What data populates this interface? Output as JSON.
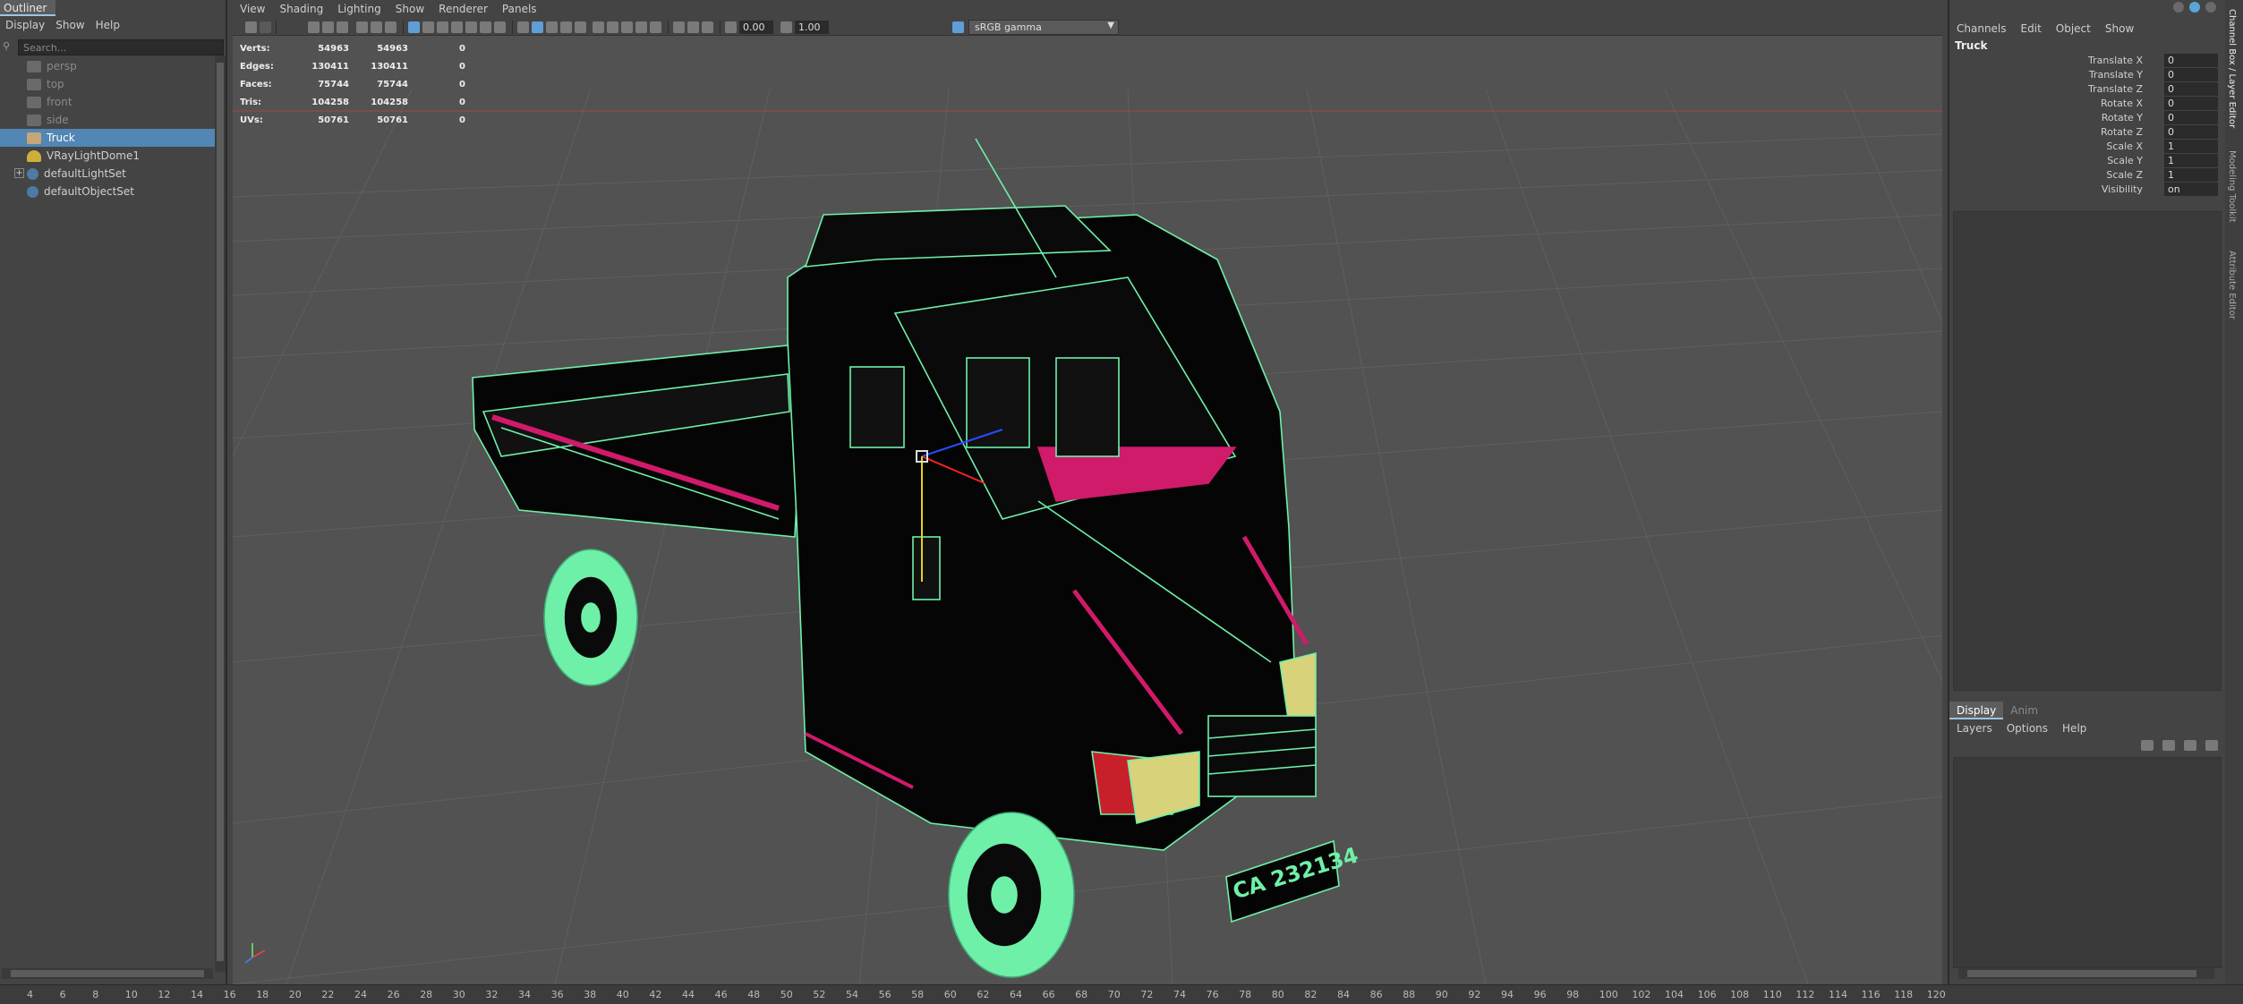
{
  "outliner": {
    "tab_label": "Outliner",
    "menu": [
      "Display",
      "Show",
      "Help"
    ],
    "search_placeholder": "Search...",
    "items": [
      {
        "label": "persp",
        "kind": "camera"
      },
      {
        "label": "top",
        "kind": "camera"
      },
      {
        "label": "front",
        "kind": "camera"
      },
      {
        "label": "side",
        "kind": "camera"
      },
      {
        "label": "Truck",
        "kind": "mesh",
        "selected": true
      },
      {
        "label": "VRayLightDome1",
        "kind": "light"
      },
      {
        "label": "defaultLightSet",
        "kind": "set",
        "expandable": true
      },
      {
        "label": "defaultObjectSet",
        "kind": "set"
      }
    ]
  },
  "viewport": {
    "menu": [
      "View",
      "Shading",
      "Lighting",
      "Show",
      "Renderer",
      "Panels"
    ],
    "toolbar": {
      "exposure": "0.00",
      "gamma": "1.00",
      "color_space": "sRGB gamma"
    },
    "hud": {
      "rows": [
        {
          "label": "Verts:",
          "v1": "54963",
          "v2": "54963",
          "v3": "0"
        },
        {
          "label": "Edges:",
          "v1": "130411",
          "v2": "130411",
          "v3": "0"
        },
        {
          "label": "Faces:",
          "v1": "75744",
          "v2": "75744",
          "v3": "0"
        },
        {
          "label": "Tris:",
          "v1": "104258",
          "v2": "104258",
          "v3": "0"
        },
        {
          "label": "UVs:",
          "v1": "50761",
          "v2": "50761",
          "v3": "0"
        }
      ]
    },
    "license_plate": "CA 232134",
    "colors": {
      "wire": "#6ff0a8",
      "body": "#050505",
      "accent_pink": "#d01a6a",
      "headlight": "#d8d27a",
      "grid": "#5e5e5e",
      "background": "#525252"
    }
  },
  "timeline": {
    "ticks": [
      "4",
      "6",
      "8",
      "10",
      "12",
      "14",
      "16",
      "18",
      "20",
      "22",
      "24",
      "26",
      "28",
      "30",
      "32",
      "34",
      "36",
      "38",
      "40",
      "42",
      "44",
      "46",
      "48",
      "50",
      "52",
      "54",
      "56",
      "58",
      "60",
      "62",
      "64",
      "66",
      "68",
      "70",
      "72",
      "74",
      "76",
      "78",
      "80",
      "82",
      "84",
      "86",
      "88",
      "90",
      "92",
      "94",
      "96",
      "98",
      "100",
      "102",
      "104",
      "106",
      "108",
      "110",
      "112",
      "114",
      "116",
      "118",
      "120"
    ]
  },
  "channel_box": {
    "menu": [
      "Channels",
      "Edit",
      "Object",
      "Show"
    ],
    "object_name": "Truck",
    "channels": [
      {
        "label": "Translate X",
        "value": "0"
      },
      {
        "label": "Translate Y",
        "value": "0"
      },
      {
        "label": "Translate Z",
        "value": "0"
      },
      {
        "label": "Rotate X",
        "value": "0"
      },
      {
        "label": "Rotate Y",
        "value": "0"
      },
      {
        "label": "Rotate Z",
        "value": "0"
      },
      {
        "label": "Scale X",
        "value": "1"
      },
      {
        "label": "Scale Y",
        "value": "1"
      },
      {
        "label": "Scale Z",
        "value": "1"
      },
      {
        "label": "Visibility",
        "value": "on"
      }
    ]
  },
  "layer_editor": {
    "tabs": [
      "Display",
      "Anim"
    ],
    "menu": [
      "Layers",
      "Options",
      "Help"
    ]
  },
  "side_tabs": [
    "Channel Box / Layer Editor",
    "Modeling Toolkit",
    "Attribute Editor"
  ]
}
